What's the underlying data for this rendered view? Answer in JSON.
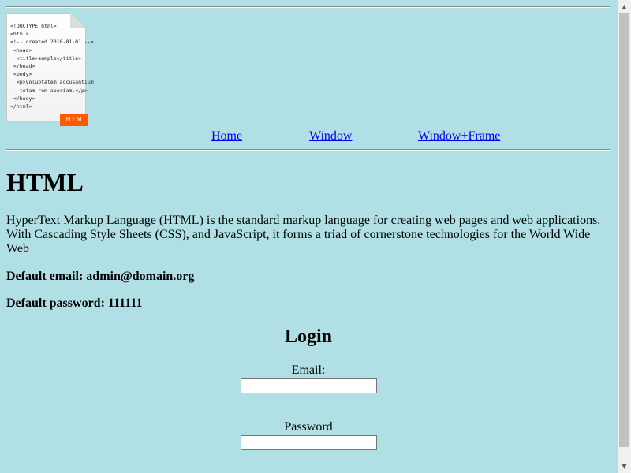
{
  "logo": {
    "code_lines": [
      "<!DOCTYPE html>",
      "<html>",
      "<!-- created 2010-01-01 -->",
      " <head>",
      "  <title>sample</title>",
      " </head>",
      " <body>",
      "  <p>Voluptatem accusantium",
      "   totam rem aperiam.</p>",
      " </body>",
      "</html>"
    ],
    "badge": "HTM"
  },
  "nav": {
    "home": "Home",
    "window": "Window",
    "window_frame": "Window+Frame"
  },
  "main": {
    "title": "HTML",
    "description": "HyperText Markup Language (HTML) is the standard markup language for creating web pages and web applications. With Cascading Style Sheets (CSS), and JavaScript, it forms a triad of cornerstone technologies for the World Wide Web",
    "default_email": "Default email: admin@domain.org",
    "default_password": "Default password: 111111"
  },
  "login": {
    "title": "Login",
    "email_label": "Email:",
    "email_value": "",
    "password_label": "Password",
    "password_value": ""
  },
  "colors": {
    "background": "#b0e0e6",
    "link": "#0000ee",
    "badge": "#ff5a00"
  },
  "scrollbar": {
    "up_arrow": "▲",
    "down_arrow": "▼"
  }
}
